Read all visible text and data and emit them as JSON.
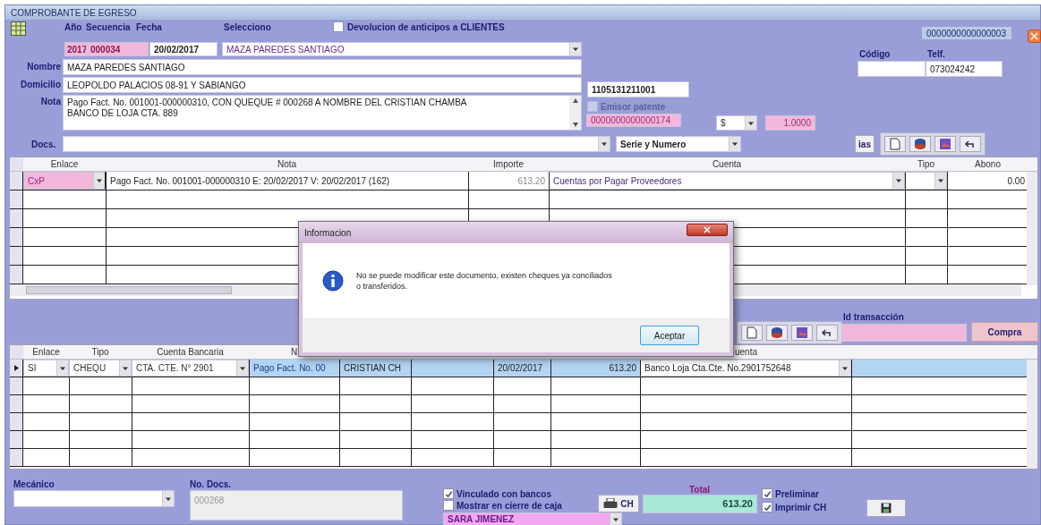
{
  "window": {
    "title": "COMPROBANTE DE EGRESO",
    "record_number": "0000000000000003"
  },
  "header": {
    "anio": {
      "label": "Año",
      "value": "2017"
    },
    "secuencia": {
      "label": "Secuencia",
      "value": "000034"
    },
    "fecha": {
      "label": "Fecha",
      "value": "20/02/2017"
    },
    "selecciono": {
      "label": "Selecciono",
      "value": "MAZA PAREDES SANTIAGO"
    },
    "devolucion": {
      "label": "Devolucion de anticipos a CLIENTES",
      "checked": false
    },
    "codigo": {
      "label": "Código"
    },
    "telf": {
      "label": "Telf.",
      "value": "073024242"
    },
    "nombre": {
      "label": "Nombre",
      "value": "MAZA PAREDES SANTIAGO"
    },
    "domicilio": {
      "label": "Domicilio",
      "value": "LEOPOLDO PALACIOS 08-91 Y SABIANGO"
    },
    "ruc": "1105131211001",
    "nota": {
      "label": "Nota",
      "value": "Pago Fact. No. 001001-000000310, CON QUEQUE # 000268 A NOMBRE DEL CRISTIAN CHAMBA\nBANCO DE LOJA CTA. 889"
    },
    "emisor": {
      "label": "Emisor patente",
      "checked": false,
      "disabled": true
    },
    "numero": "0000000000000174",
    "moneda": "$",
    "cotizacion": "1.0000",
    "docs": {
      "label": "Docs."
    },
    "serie": "Serie y Numero",
    "ias_button": "ias"
  },
  "grid1": {
    "columns": [
      "Enlace",
      "Nota",
      "Importe",
      "Cuenta",
      "Tipo",
      "Abono"
    ],
    "rows": [
      {
        "enlace": "CxP",
        "nota": "Pago Fact. No. 001001-000000310  E: 20/02/2017  V: 20/02/2017 (162)",
        "importe": "613.20",
        "cuenta": "Cuentas por Pagar Proveedores",
        "abono": "0.00"
      }
    ]
  },
  "transaccion": {
    "label": "Id transacción",
    "button": "Compra"
  },
  "grid2": {
    "columns": [
      "Enlace",
      "Tipo",
      "Cuenta Bancaria",
      "N",
      "uenta"
    ],
    "rows": [
      {
        "selected": true,
        "enlace": "SI",
        "tipo": "CHEQU",
        "cuenta_bancaria": "CTA. CTE. N° 2901",
        "nota": "Pago Fact. No. 00",
        "nombre": "CRISTIAN CH",
        "fecha": "20/02/2017",
        "importe": "613.20",
        "cuenta": "Banco Loja Cta.Cte. No.2901752648"
      }
    ]
  },
  "footer": {
    "mecanico": {
      "label": "Mecánico"
    },
    "no_docs": {
      "label": "No. Docs.",
      "value": "000268"
    },
    "vinculado": {
      "label": "Vinculado con bancos",
      "checked": true
    },
    "mostrar": {
      "label": "Mostrar en cierre de caja",
      "checked": false
    },
    "vendedor": "SARA JIMENEZ",
    "ch_button": "CH",
    "total": {
      "label": "Total",
      "value": "613.20"
    },
    "preliminar": {
      "label": "Preliminar",
      "checked": true
    },
    "imprimir": {
      "label": "Imprimir CH",
      "checked": true
    }
  },
  "dialog": {
    "title": "Informacion",
    "message": "No se puede modificar este documento, existen cheques ya conciliados\no transferidos.",
    "button": "Aceptar"
  }
}
